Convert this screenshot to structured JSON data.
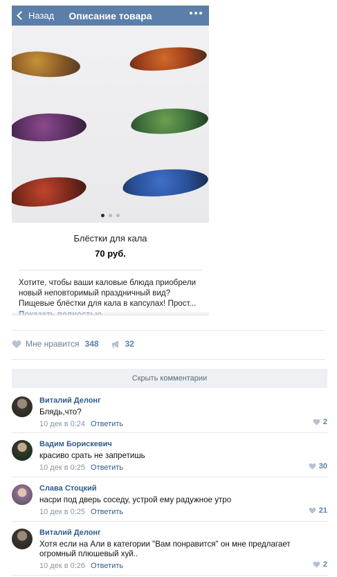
{
  "navbar": {
    "back_label": "Назад",
    "title": "Описание товара"
  },
  "gallery": {
    "page_count": 3,
    "active_index": 0
  },
  "product": {
    "name": "Блёстки для кала",
    "price": "70 руб.",
    "description_lines": [
      "Хотите, чтобы ваши каловые блюда приобрели",
      "новый неповторимый праздничный вид?",
      "Пищевые блёстки для кала в капсулах! Прост..."
    ],
    "show_more_label": "Показать полностью.."
  },
  "post_actions": {
    "like_label": "Мне нравится",
    "like_count": "348",
    "share_count": "32"
  },
  "hide_comments_label": "Скрыть комментарии",
  "comments": [
    {
      "author": "Виталий Делонг",
      "text": "Блядь,что?",
      "date": "10 дек в 0:24",
      "reply_label": "Ответить",
      "likes": "2"
    },
    {
      "author": "Вадим Борискевич",
      "text": "красиво срать не запретишь",
      "date": "10 дек в 0:25",
      "reply_label": "Ответить",
      "likes": "30"
    },
    {
      "author": "Слава Стоцкий",
      "text": "насри под дверь соседу, устрой ему радужное утро",
      "date": "10 дек в 0:25",
      "reply_label": "Ответить",
      "likes": "21"
    },
    {
      "author": "Виталий Делонг",
      "text_lines": [
        "Хотя если на Али в категории \"Вам понравится\" он мне предлагает",
        "огромный плюшевый хуй.."
      ],
      "date": "10 дек в 0:26",
      "reply_label": "Ответить",
      "likes": "2"
    }
  ],
  "colors": {
    "navbar": "#5b7fa8",
    "link": "#2f5b8b",
    "muted": "#8a95a1"
  }
}
